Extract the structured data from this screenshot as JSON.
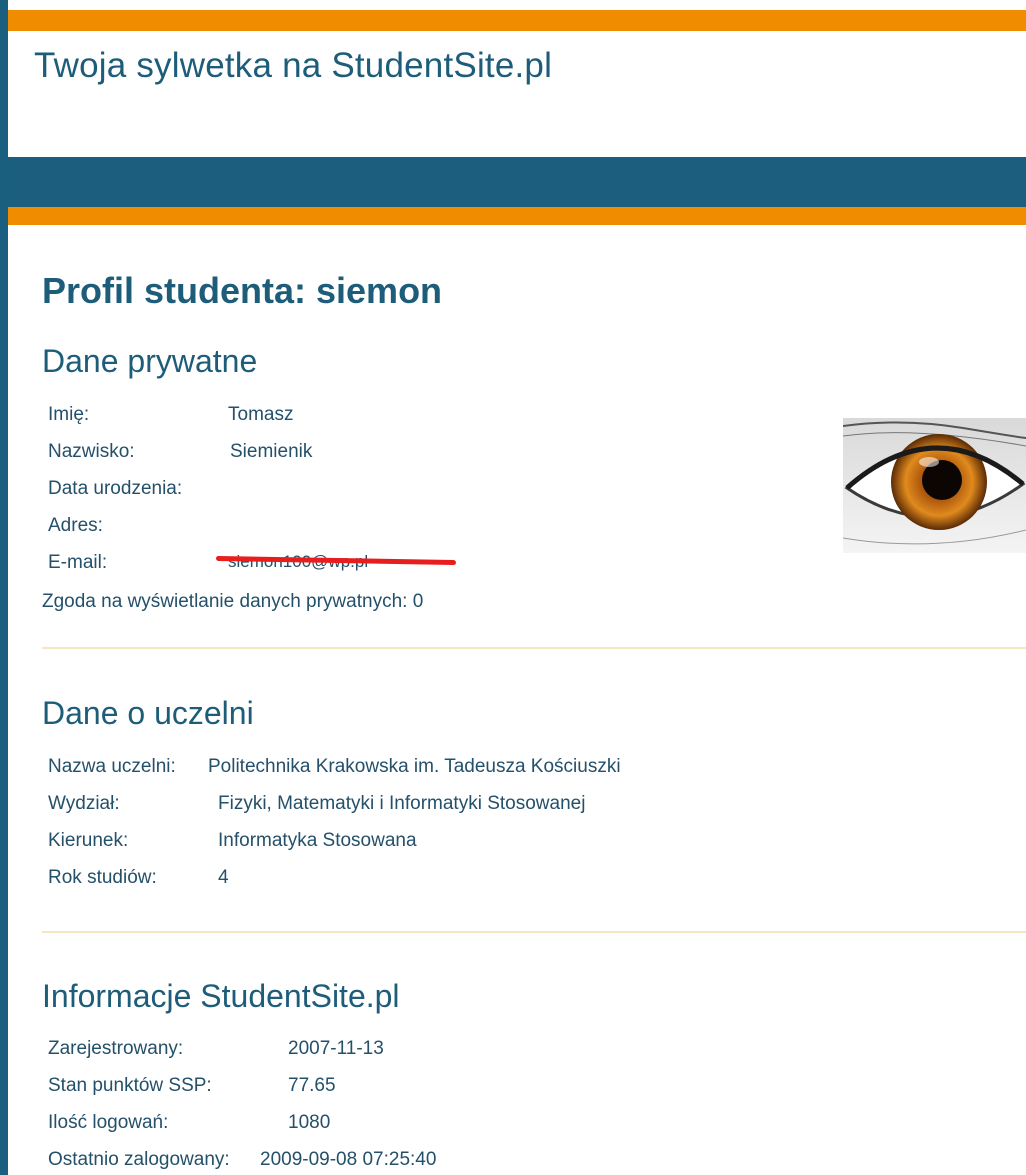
{
  "header": {
    "site_title": "Twoja sylwetka na StudentSite.pl"
  },
  "profile": {
    "title": "Profil studenta: siemon"
  },
  "private": {
    "heading": "Dane prywatne",
    "rows": [
      {
        "label": "Imię:",
        "value": "Tomasz"
      },
      {
        "label": "Nazwisko:",
        "value": "Siemienik"
      },
      {
        "label": "Data urodzenia:",
        "value": ""
      },
      {
        "label": "Adres:",
        "value": ""
      },
      {
        "label": "E-mail:",
        "value": "siemon100@wp.pl"
      }
    ],
    "consent": "Zgoda na wyświetlanie danych prywatnych: 0",
    "avatar_icon": "eye-photo"
  },
  "university": {
    "heading": "Dane o uczelni",
    "rows": [
      {
        "label": "Nazwa uczelni:",
        "value": "Politechnika Krakowska im. Tadeusza Kościuszki"
      },
      {
        "label": "Wydział:",
        "value": "Fizyki, Matematyki i Informatyki Stosowanej"
      },
      {
        "label": "Kierunek:",
        "value": "Informatyka Stosowana"
      },
      {
        "label": "Rok studiów:",
        "value": "4"
      }
    ]
  },
  "site_info": {
    "heading": "Informacje StudentSite.pl",
    "rows": [
      {
        "label": "Zarejestrowany:",
        "value": "2007-11-13"
      },
      {
        "label": "Stan punktów SSP:",
        "value": "77.65"
      },
      {
        "label": "Ilość logowań:",
        "value": "1080"
      },
      {
        "label": "Ostatnio zalogowany:",
        "value": "2009-09-08 07:25:40"
      }
    ]
  },
  "colors": {
    "orange": "#f08c00",
    "blue": "#1b5e7e",
    "text": "#1d5d7a",
    "redaction": "#e81e1e"
  }
}
